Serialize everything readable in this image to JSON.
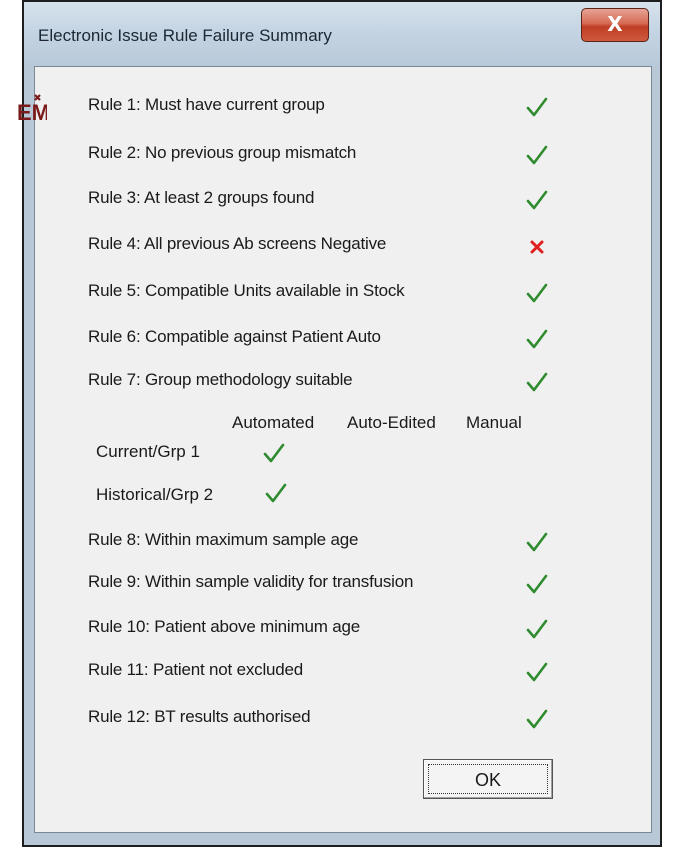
{
  "window": {
    "title": "Electronic Issue Rule Failure Summary",
    "close_label": "X"
  },
  "logo": {
    "text": "EM"
  },
  "rules": [
    {
      "label": "Rule 1:  Must have current group",
      "status": "pass"
    },
    {
      "label": "Rule 2:  No previous group mismatch",
      "status": "pass"
    },
    {
      "label": "Rule 3:  At least 2 groups found",
      "status": "pass"
    },
    {
      "label": "Rule 4:  All previous Ab screens Negative",
      "status": "fail"
    },
    {
      "label": "Rule 5:  Compatible Units available in Stock",
      "status": "pass"
    },
    {
      "label": "Rule 6:  Compatible against Patient Auto",
      "status": "pass"
    },
    {
      "label": "Rule 7:  Group methodology suitable",
      "status": "pass"
    },
    {
      "label": "Rule 8:  Within maximum sample age",
      "status": "pass"
    },
    {
      "label": "Rule 9:  Within sample validity for transfusion",
      "status": "pass"
    },
    {
      "label": "Rule 10:  Patient above minimum age",
      "status": "pass"
    },
    {
      "label": "Rule 11:  Patient not excluded",
      "status": "pass"
    },
    {
      "label": "Rule 12:  BT results authorised",
      "status": "pass"
    }
  ],
  "methodology": {
    "columns": [
      "Automated",
      "Auto-Edited",
      "Manual"
    ],
    "rows": [
      {
        "label": "Current/Grp 1",
        "checked": "Automated"
      },
      {
        "label": "Historical/Grp 2",
        "checked": "Automated"
      }
    ]
  },
  "ok_label": "OK",
  "colors": {
    "pass": "#2e8b2e",
    "fail": "#e02020",
    "logo": "#7a1a1a"
  }
}
